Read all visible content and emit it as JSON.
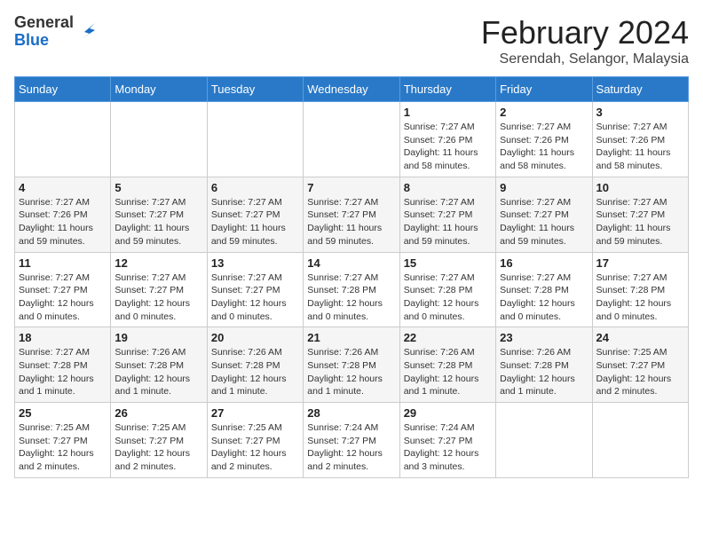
{
  "logo": {
    "general": "General",
    "blue": "Blue"
  },
  "header": {
    "month_year": "February 2024",
    "location": "Serendah, Selangor, Malaysia"
  },
  "days_of_week": [
    "Sunday",
    "Monday",
    "Tuesday",
    "Wednesday",
    "Thursday",
    "Friday",
    "Saturday"
  ],
  "weeks": [
    [
      {
        "day": "",
        "info": ""
      },
      {
        "day": "",
        "info": ""
      },
      {
        "day": "",
        "info": ""
      },
      {
        "day": "",
        "info": ""
      },
      {
        "day": "1",
        "info": "Sunrise: 7:27 AM\nSunset: 7:26 PM\nDaylight: 11 hours\nand 58 minutes."
      },
      {
        "day": "2",
        "info": "Sunrise: 7:27 AM\nSunset: 7:26 PM\nDaylight: 11 hours\nand 58 minutes."
      },
      {
        "day": "3",
        "info": "Sunrise: 7:27 AM\nSunset: 7:26 PM\nDaylight: 11 hours\nand 58 minutes."
      }
    ],
    [
      {
        "day": "4",
        "info": "Sunrise: 7:27 AM\nSunset: 7:26 PM\nDaylight: 11 hours\nand 59 minutes."
      },
      {
        "day": "5",
        "info": "Sunrise: 7:27 AM\nSunset: 7:27 PM\nDaylight: 11 hours\nand 59 minutes."
      },
      {
        "day": "6",
        "info": "Sunrise: 7:27 AM\nSunset: 7:27 PM\nDaylight: 11 hours\nand 59 minutes."
      },
      {
        "day": "7",
        "info": "Sunrise: 7:27 AM\nSunset: 7:27 PM\nDaylight: 11 hours\nand 59 minutes."
      },
      {
        "day": "8",
        "info": "Sunrise: 7:27 AM\nSunset: 7:27 PM\nDaylight: 11 hours\nand 59 minutes."
      },
      {
        "day": "9",
        "info": "Sunrise: 7:27 AM\nSunset: 7:27 PM\nDaylight: 11 hours\nand 59 minutes."
      },
      {
        "day": "10",
        "info": "Sunrise: 7:27 AM\nSunset: 7:27 PM\nDaylight: 11 hours\nand 59 minutes."
      }
    ],
    [
      {
        "day": "11",
        "info": "Sunrise: 7:27 AM\nSunset: 7:27 PM\nDaylight: 12 hours\nand 0 minutes."
      },
      {
        "day": "12",
        "info": "Sunrise: 7:27 AM\nSunset: 7:27 PM\nDaylight: 12 hours\nand 0 minutes."
      },
      {
        "day": "13",
        "info": "Sunrise: 7:27 AM\nSunset: 7:27 PM\nDaylight: 12 hours\nand 0 minutes."
      },
      {
        "day": "14",
        "info": "Sunrise: 7:27 AM\nSunset: 7:28 PM\nDaylight: 12 hours\nand 0 minutes."
      },
      {
        "day": "15",
        "info": "Sunrise: 7:27 AM\nSunset: 7:28 PM\nDaylight: 12 hours\nand 0 minutes."
      },
      {
        "day": "16",
        "info": "Sunrise: 7:27 AM\nSunset: 7:28 PM\nDaylight: 12 hours\nand 0 minutes."
      },
      {
        "day": "17",
        "info": "Sunrise: 7:27 AM\nSunset: 7:28 PM\nDaylight: 12 hours\nand 0 minutes."
      }
    ],
    [
      {
        "day": "18",
        "info": "Sunrise: 7:27 AM\nSunset: 7:28 PM\nDaylight: 12 hours\nand 1 minute."
      },
      {
        "day": "19",
        "info": "Sunrise: 7:26 AM\nSunset: 7:28 PM\nDaylight: 12 hours\nand 1 minute."
      },
      {
        "day": "20",
        "info": "Sunrise: 7:26 AM\nSunset: 7:28 PM\nDaylight: 12 hours\nand 1 minute."
      },
      {
        "day": "21",
        "info": "Sunrise: 7:26 AM\nSunset: 7:28 PM\nDaylight: 12 hours\nand 1 minute."
      },
      {
        "day": "22",
        "info": "Sunrise: 7:26 AM\nSunset: 7:28 PM\nDaylight: 12 hours\nand 1 minute."
      },
      {
        "day": "23",
        "info": "Sunrise: 7:26 AM\nSunset: 7:28 PM\nDaylight: 12 hours\nand 1 minute."
      },
      {
        "day": "24",
        "info": "Sunrise: 7:25 AM\nSunset: 7:27 PM\nDaylight: 12 hours\nand 2 minutes."
      }
    ],
    [
      {
        "day": "25",
        "info": "Sunrise: 7:25 AM\nSunset: 7:27 PM\nDaylight: 12 hours\nand 2 minutes."
      },
      {
        "day": "26",
        "info": "Sunrise: 7:25 AM\nSunset: 7:27 PM\nDaylight: 12 hours\nand 2 minutes."
      },
      {
        "day": "27",
        "info": "Sunrise: 7:25 AM\nSunset: 7:27 PM\nDaylight: 12 hours\nand 2 minutes."
      },
      {
        "day": "28",
        "info": "Sunrise: 7:24 AM\nSunset: 7:27 PM\nDaylight: 12 hours\nand 2 minutes."
      },
      {
        "day": "29",
        "info": "Sunrise: 7:24 AM\nSunset: 7:27 PM\nDaylight: 12 hours\nand 3 minutes."
      },
      {
        "day": "",
        "info": ""
      },
      {
        "day": "",
        "info": ""
      }
    ]
  ]
}
